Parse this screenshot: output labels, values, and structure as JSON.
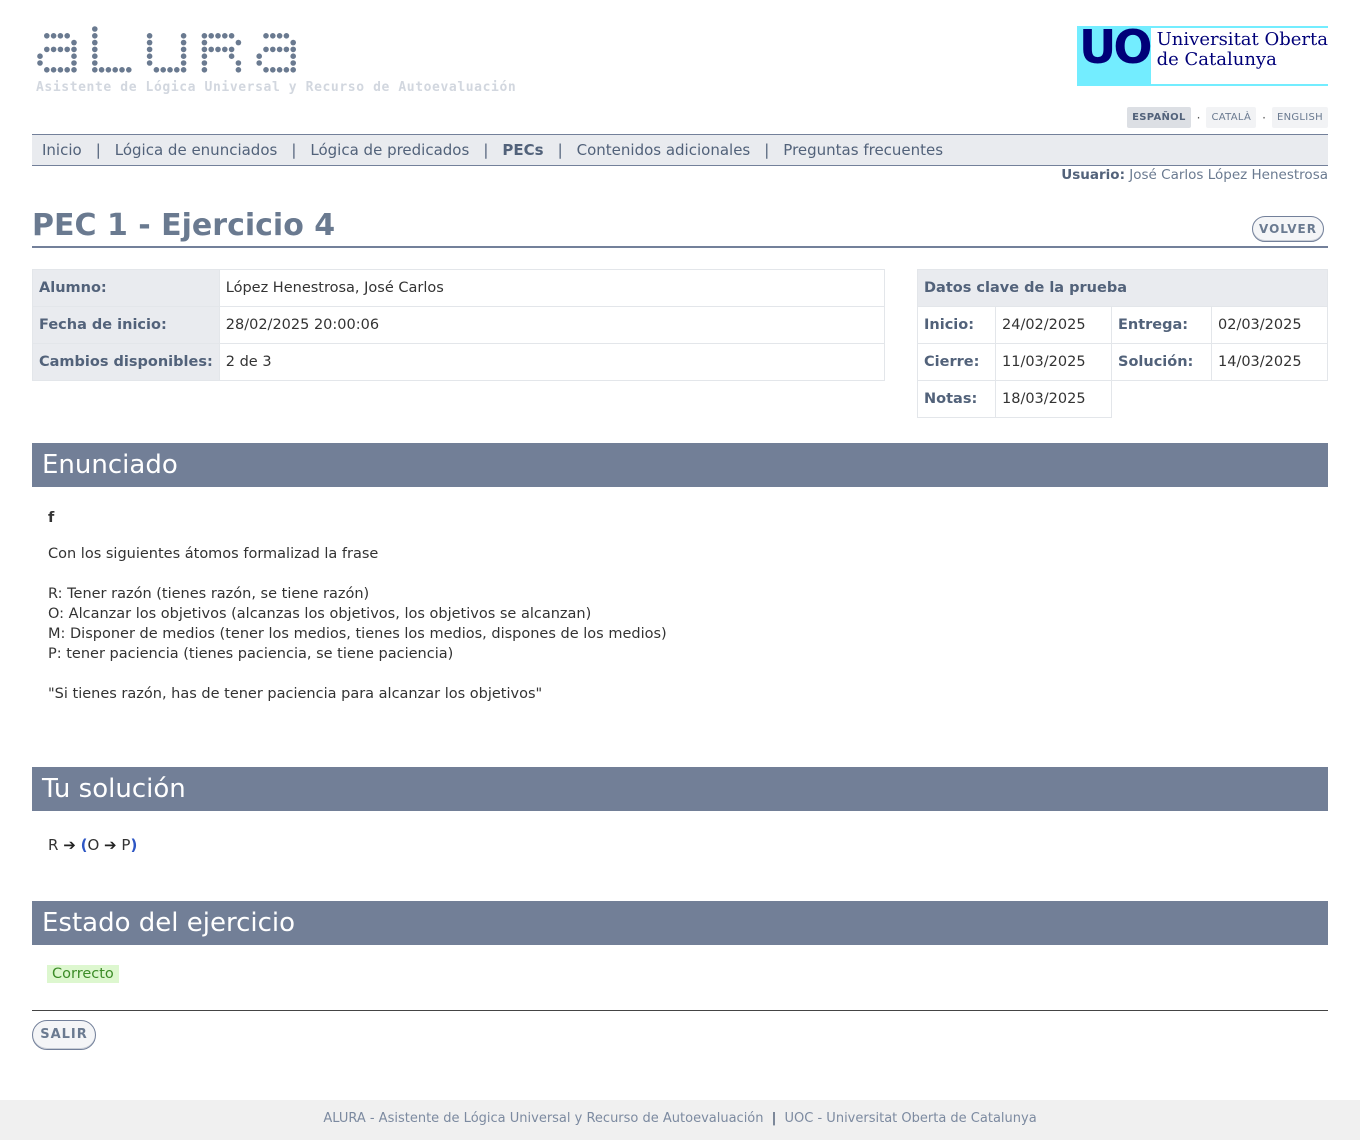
{
  "header": {
    "logo_text": "ALURA",
    "logo_subtitle": "Asistente de Lógica Universal y Recurso de Autoevaluación",
    "uoc_mark": "UOC",
    "uoc_line1": "Universitat Oberta",
    "uoc_line2": "de Catalunya"
  },
  "languages": {
    "es": "ESPAÑOL",
    "ca": "CATALÀ",
    "en": "ENGLISH",
    "separator": "·"
  },
  "nav": {
    "items": [
      "Inicio",
      "Lógica de enunciados",
      "Lógica de predicados",
      "PECs",
      "Contenidos adicionales",
      "Preguntas frecuentes"
    ],
    "active": "PECs",
    "separator": "|"
  },
  "user": {
    "label": "Usuario:",
    "name": "José Carlos López Henestrosa"
  },
  "page": {
    "title": "PEC 1 - Ejercicio 4",
    "back_button": "VOLVER"
  },
  "student_info": {
    "alumno_label": "Alumno:",
    "alumno_value": "López Henestrosa, José Carlos",
    "fecha_label": "Fecha de inicio:",
    "fecha_value": "28/02/2025 20:00:06",
    "cambios_label": "Cambios disponibles:",
    "cambios_value": "2 de 3"
  },
  "key_dates": {
    "title": "Datos clave de la prueba",
    "inicio_label": "Inicio:",
    "inicio_value": "24/02/2025",
    "entrega_label": "Entrega:",
    "entrega_value": "02/03/2025",
    "cierre_label": "Cierre:",
    "cierre_value": "11/03/2025",
    "solucion_label": "Solución:",
    "solucion_value": "14/03/2025",
    "notas_label": "Notas:",
    "notas_value": "18/03/2025"
  },
  "enunciado": {
    "heading": "Enunciado",
    "label": "f",
    "intro": "Con los siguientes átomos formalizad la frase",
    "atoms": [
      "R: Tener razón (tienes razón, se tiene razón)",
      "O: Alcanzar los objetivos (alcanzas los objetivos, los objetivos se alcanzan)",
      "M: Disponer de medios (tener los medios, tienes los medios, dispones de los medios)",
      "P: tener paciencia (tienes paciencia, se tiene paciencia)"
    ],
    "sentence": "\"Si tienes razón, has de tener paciencia para alcanzar los objetivos\""
  },
  "solution": {
    "heading": "Tu solución",
    "atom1": "R",
    "arrow": "➔",
    "open_paren": "(",
    "atom2": "O",
    "atom3": "P",
    "close_paren": ")"
  },
  "status": {
    "heading": "Estado del ejercicio",
    "value": "Correcto"
  },
  "actions": {
    "exit": "SALIR"
  },
  "footer": {
    "left": "ALURA - Asistente de Lógica Universal y Recurso de Autoevaluación",
    "sep": "|",
    "right": "UOC - Universitat Oberta de Catalunya"
  },
  "colors": {
    "accent": "#727f97",
    "logo_dots": "#6a7a90",
    "uoc_cyan": "#73edff",
    "uoc_navy": "#000078",
    "correct_bg": "#ddf7cf",
    "correct_text": "#3c8c28"
  }
}
